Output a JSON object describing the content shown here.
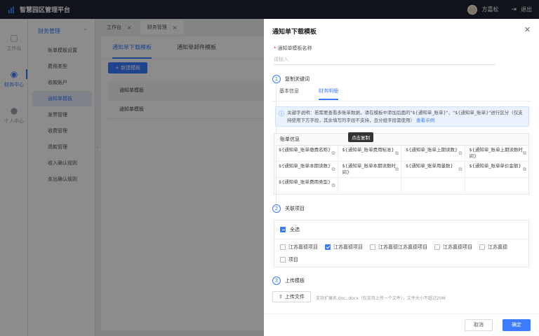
{
  "header": {
    "app_title": "智慧园区管理平台",
    "user_name": "方嘉松",
    "logout_label": "退出"
  },
  "rail": [
    {
      "label": "工作台",
      "icon": "desk-icon"
    },
    {
      "label": "财务中心",
      "icon": "finance-icon",
      "active": true
    },
    {
      "label": "个人中心",
      "icon": "person-icon"
    }
  ],
  "sidebar": {
    "group": "财务管理",
    "items": [
      "账单模板设置",
      "费用类型",
      "收款账户",
      "通知单模板",
      "发票管理",
      "收费管理",
      "退款管理",
      "收入确认规则",
      "支出确认规则"
    ],
    "active_index": 3
  },
  "tabs": [
    {
      "label": "工作台"
    },
    {
      "label": "财务管理",
      "active": true
    }
  ],
  "main": {
    "tabs": [
      "通知单下载模板",
      "通知单邮件模板"
    ],
    "new_button": "+ 新建模板",
    "rows": [
      "通知单模板",
      "通知单模板"
    ]
  },
  "drawer": {
    "title": "通知单下载模板",
    "name_label": "通知单模板名称",
    "name_placeholder": "请输入",
    "step1": {
      "num": "1",
      "title": "复制关键词"
    },
    "subtabs": [
      "基本信息",
      "财务明细"
    ],
    "tip": {
      "text": "关键字说明：若需要查看多账单数据，请在模板中添加后面的\"${通知单_账单}\"、\"${通知单_账单}\"进行区分（仅支持使用下方字段，其余填写的字段不支持，且分组字段需使用）",
      "link": "查看示例"
    },
    "grid": {
      "header": "账单信息",
      "rows": [
        [
          "${通知单_账单缴费名称}",
          "${通知单_账单费用标准}",
          "${通知单_账单上期读数}",
          "${通知单_账单上期读数时间}"
        ],
        [
          "${通知单_账单本期读数}",
          "${通知单_账单本期读数时间}",
          "${通知单_账单用量数}",
          "${通知单_账单单价金额}"
        ],
        [
          "${通知单_账单费用类型}",
          "",
          "",
          ""
        ]
      ],
      "tooltip": "点击复制"
    },
    "step2": {
      "num": "2",
      "title": "关联项目"
    },
    "projects": {
      "all_label": "全选",
      "items": [
        {
          "label": "江苏嘉德项目",
          "checked": false
        },
        {
          "label": "江苏嘉德项目",
          "checked": true
        },
        {
          "label": "江苏嘉德江苏嘉德项目",
          "checked": false
        },
        {
          "label": "江苏嘉德项目",
          "checked": false
        },
        {
          "label": "江苏嘉德",
          "checked": false
        },
        {
          "label": "项目",
          "checked": false
        }
      ]
    },
    "step3": {
      "num": "3",
      "title": "上传模板"
    },
    "upload": {
      "button": "上传文件",
      "hint": "支持扩展名.doc,.docx（仅支持上传一个文件），文件大小不超过20M"
    },
    "cancel": "取消",
    "ok": "确定"
  },
  "colors": {
    "accent": "#3a7bff",
    "topbar": "#1f2430"
  }
}
